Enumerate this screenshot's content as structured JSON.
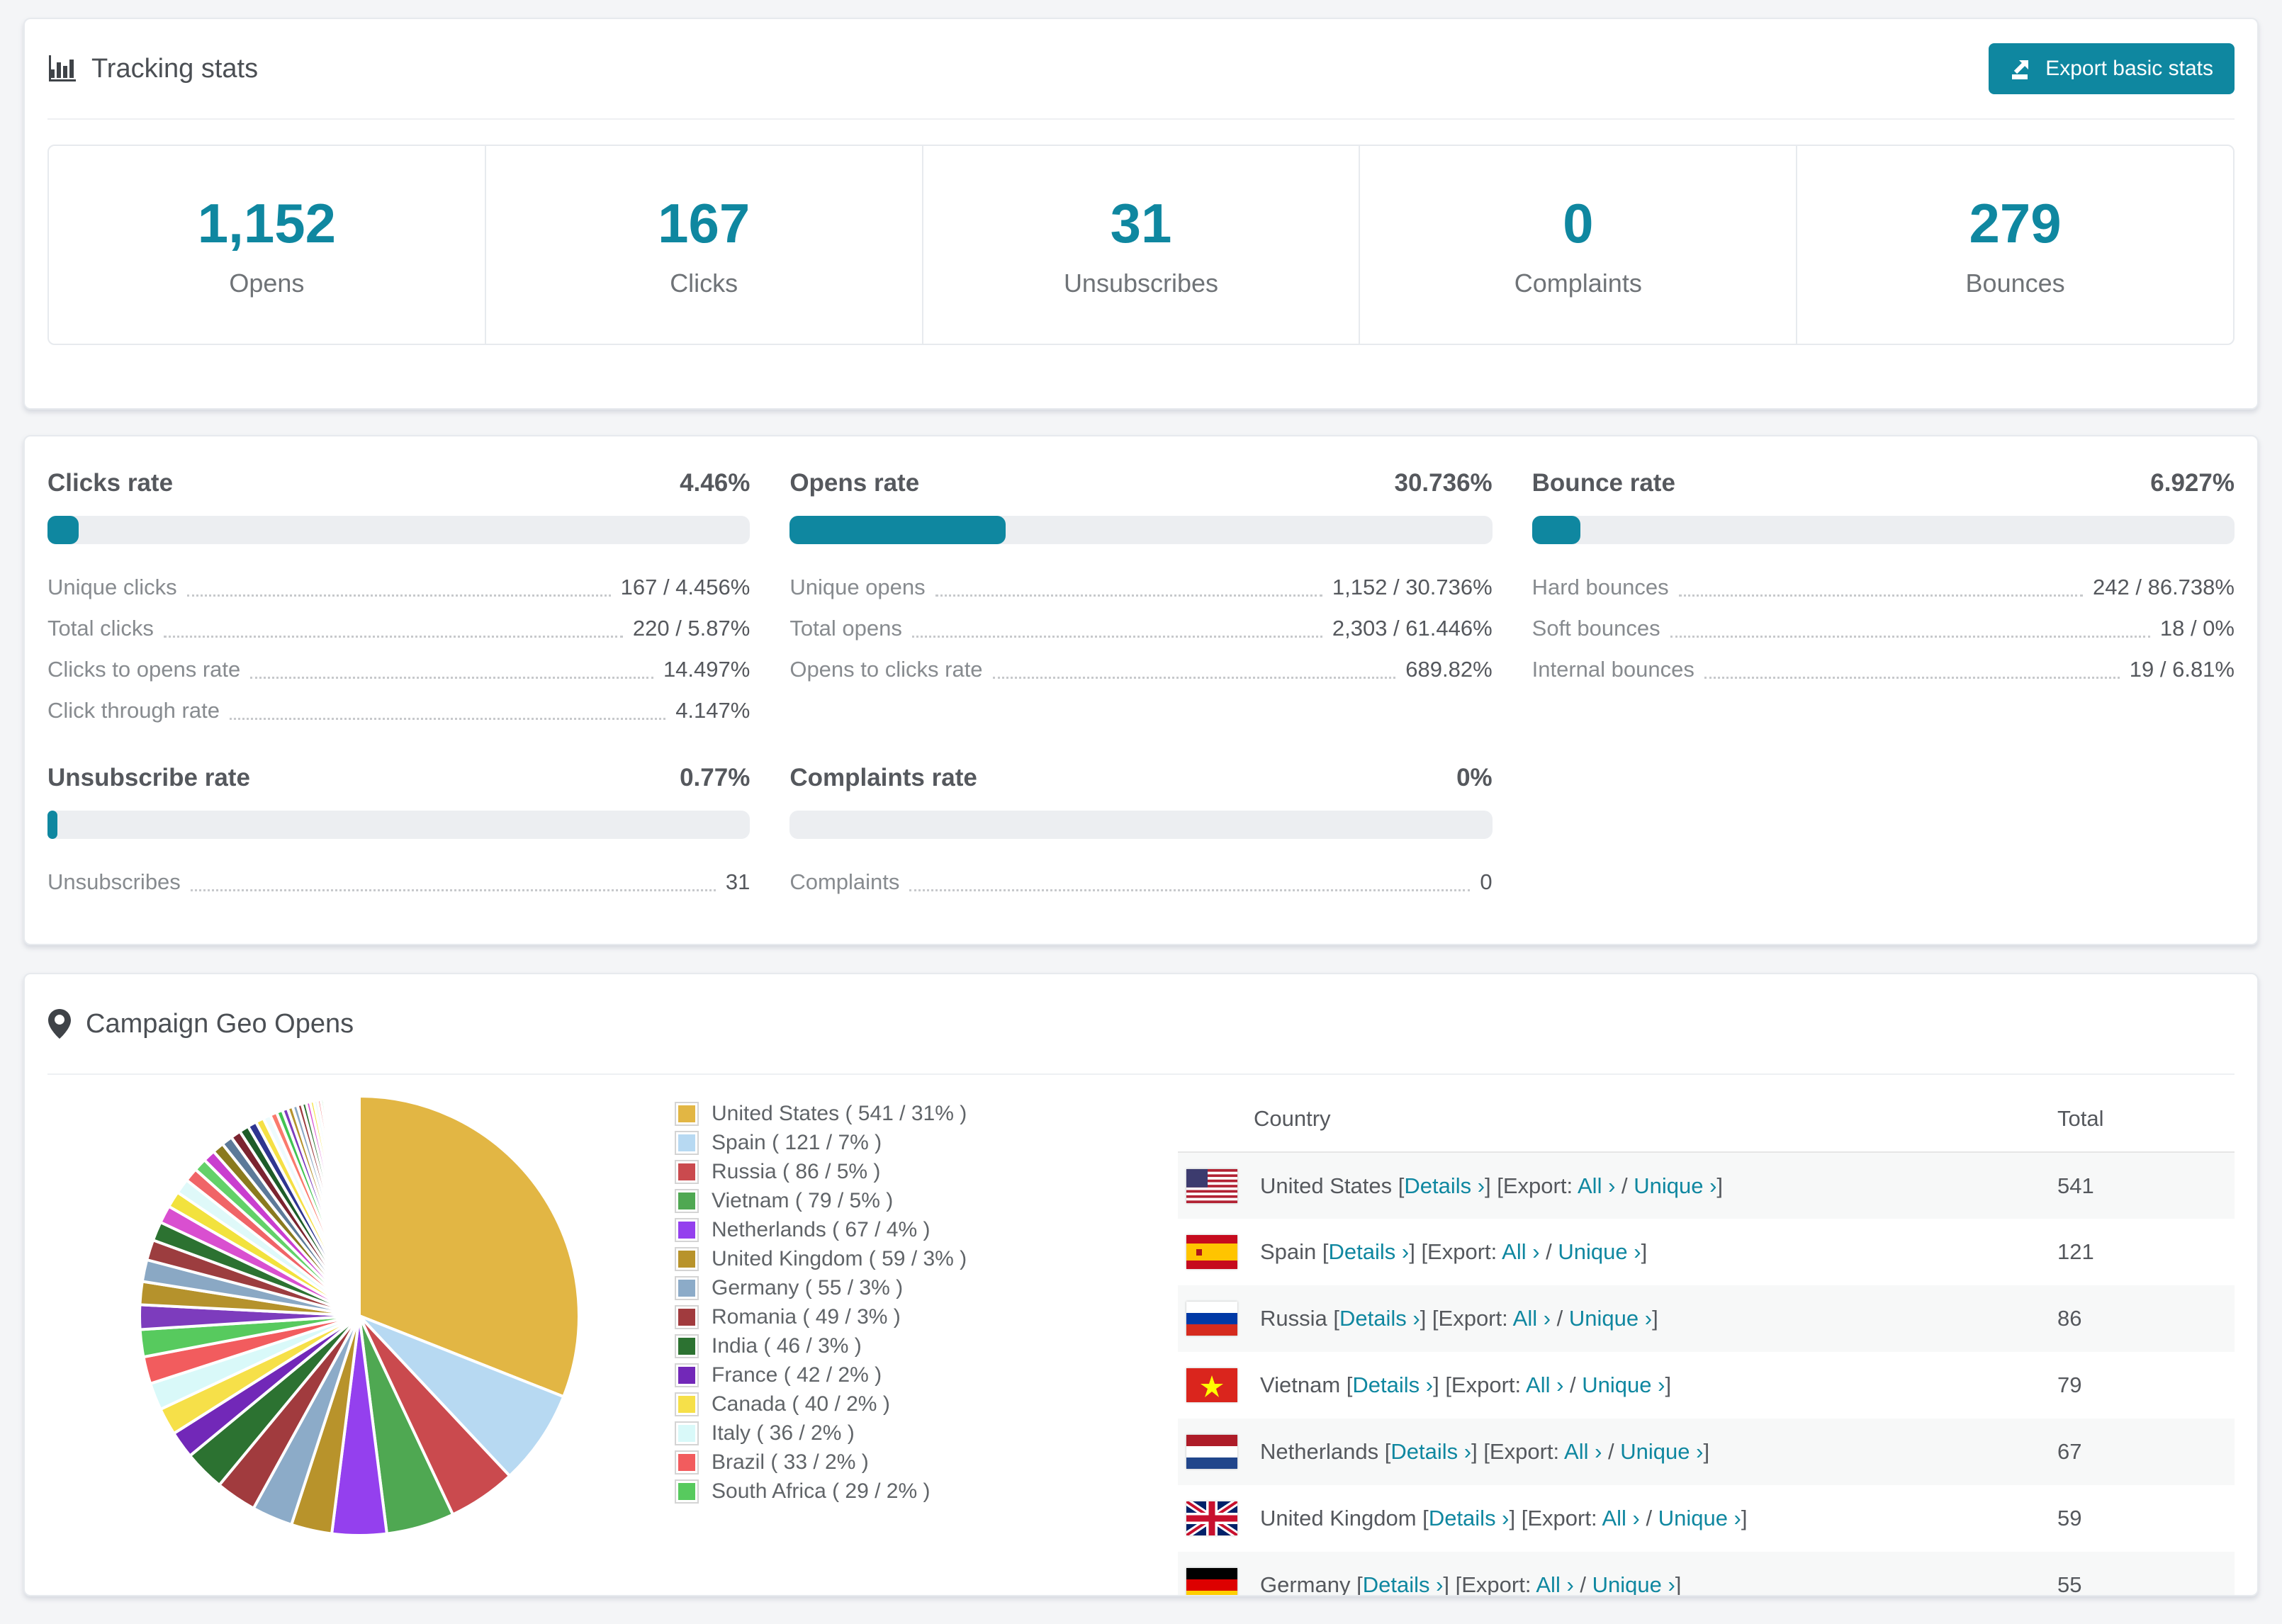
{
  "accent": "#0f87a0",
  "tracking": {
    "title": "Tracking stats",
    "export_button": "Export basic stats",
    "summary": [
      {
        "value": "1,152",
        "label": "Opens"
      },
      {
        "value": "167",
        "label": "Clicks"
      },
      {
        "value": "31",
        "label": "Unsubscribes"
      },
      {
        "value": "0",
        "label": "Complaints"
      },
      {
        "value": "279",
        "label": "Bounces"
      }
    ]
  },
  "rates": {
    "blocks": [
      {
        "title": "Clicks rate",
        "percent": "4.46%",
        "bar_pct": 4.46,
        "rows": [
          [
            "Unique clicks",
            "167 / 4.456%"
          ],
          [
            "Total clicks",
            "220 / 5.87%"
          ],
          [
            "Clicks to opens rate",
            "14.497%"
          ],
          [
            "Click through rate",
            "4.147%"
          ]
        ]
      },
      {
        "title": "Opens rate",
        "percent": "30.736%",
        "bar_pct": 30.736,
        "rows": [
          [
            "Unique opens",
            "1,152 / 30.736%"
          ],
          [
            "Total opens",
            "2,303 / 61.446%"
          ],
          [
            "Opens to clicks rate",
            "689.82%"
          ]
        ]
      },
      {
        "title": "Bounce rate",
        "percent": "6.927%",
        "bar_pct": 6.927,
        "rows": [
          [
            "Hard bounces",
            "242 / 86.738%"
          ],
          [
            "Soft bounces",
            "18 / 0%"
          ],
          [
            "Internal bounces",
            "19 / 6.81%"
          ]
        ]
      },
      {
        "title": "Unsubscribe rate",
        "percent": "0.77%",
        "bar_pct": 0.77,
        "rows": [
          [
            "Unsubscribes",
            "31"
          ]
        ]
      },
      {
        "title": "Complaints rate",
        "percent": "0%",
        "bar_pct": 0,
        "rows": [
          [
            "Complaints",
            "0"
          ]
        ]
      }
    ]
  },
  "geo": {
    "title": "Campaign Geo Opens",
    "legend": [
      {
        "name": "United States",
        "count": 541,
        "pct": 31,
        "color": "#e2b644",
        "flag": "us"
      },
      {
        "name": "Spain",
        "count": 121,
        "pct": 7,
        "color": "#b7d9f2",
        "flag": "es"
      },
      {
        "name": "Russia",
        "count": 86,
        "pct": 5,
        "color": "#ca4a4e",
        "flag": "ru"
      },
      {
        "name": "Vietnam",
        "count": 79,
        "pct": 5,
        "color": "#4fa852",
        "flag": "vn"
      },
      {
        "name": "Netherlands",
        "count": 67,
        "pct": 4,
        "color": "#9440ee",
        "flag": "nl"
      },
      {
        "name": "United Kingdom",
        "count": 59,
        "pct": 3,
        "color": "#b8932b",
        "flag": "gb"
      },
      {
        "name": "Germany",
        "count": 55,
        "pct": 3,
        "color": "#8cabc8",
        "flag": "de"
      },
      {
        "name": "Romania",
        "count": 49,
        "pct": 3,
        "color": "#a13b3e",
        "flag": "ro"
      },
      {
        "name": "India",
        "count": 46,
        "pct": 3,
        "color": "#2c7231",
        "flag": "in"
      },
      {
        "name": "France",
        "count": 42,
        "pct": 2,
        "color": "#7228b8",
        "flag": "fr"
      },
      {
        "name": "Canada",
        "count": 40,
        "pct": 2,
        "color": "#f6e049",
        "flag": "ca"
      },
      {
        "name": "Italy",
        "count": 36,
        "pct": 2,
        "color": "#d9f9f9",
        "flag": "it"
      },
      {
        "name": "Brazil",
        "count": 33,
        "pct": 2,
        "color": "#f25c5e",
        "flag": "br"
      },
      {
        "name": "South Africa",
        "count": 29,
        "pct": 2,
        "color": "#57ca5e",
        "flag": "za"
      }
    ],
    "table": {
      "headers": {
        "country": "Country",
        "total": "Total"
      },
      "link_labels": {
        "details": "Details ›",
        "export_prefix": "[Export:",
        "all": "All ›",
        "unique": "Unique ›"
      },
      "rows": [
        {
          "flag": "us",
          "name": "United States",
          "total": "541"
        },
        {
          "flag": "es",
          "name": "Spain",
          "total": "121"
        },
        {
          "flag": "ru",
          "name": "Russia",
          "total": "86"
        },
        {
          "flag": "vn",
          "name": "Vietnam",
          "total": "79"
        },
        {
          "flag": "nl",
          "name": "Netherlands",
          "total": "67"
        },
        {
          "flag": "gb",
          "name": "United Kingdom",
          "total": "59"
        },
        {
          "flag": "de",
          "name": "Germany",
          "total": "55"
        }
      ]
    }
  },
  "chart_data": {
    "type": "pie",
    "title": "Campaign Geo Opens",
    "legend_position": "right",
    "start_angle_deg": 0,
    "direction": "clockwise",
    "slices": [
      {
        "label": "United States",
        "value": 31,
        "count": 541,
        "color": "#e2b644"
      },
      {
        "label": "Spain",
        "value": 7,
        "count": 121,
        "color": "#b7d9f2"
      },
      {
        "label": "Russia",
        "value": 5,
        "count": 86,
        "color": "#ca4a4e"
      },
      {
        "label": "Vietnam",
        "value": 5,
        "count": 79,
        "color": "#4fa852"
      },
      {
        "label": "Netherlands",
        "value": 4,
        "count": 67,
        "color": "#9440ee"
      },
      {
        "label": "United Kingdom",
        "value": 3,
        "count": 59,
        "color": "#b8932b"
      },
      {
        "label": "Germany",
        "value": 3,
        "count": 55,
        "color": "#8cabc8"
      },
      {
        "label": "Romania",
        "value": 3,
        "count": 49,
        "color": "#a13b3e"
      },
      {
        "label": "India",
        "value": 3,
        "count": 46,
        "color": "#2c7231"
      },
      {
        "label": "France",
        "value": 2,
        "count": 42,
        "color": "#7228b8"
      },
      {
        "label": "Canada",
        "value": 2,
        "count": 40,
        "color": "#f6e049"
      },
      {
        "label": "Italy",
        "value": 2,
        "count": 36,
        "color": "#d9f9f9"
      },
      {
        "label": "Brazil",
        "value": 2,
        "count": 33,
        "color": "#f25c5e"
      },
      {
        "label": "South Africa",
        "value": 2,
        "count": 29,
        "color": "#57ca5e"
      }
    ],
    "others": {
      "note": "long tail of small countries, each ~1% or less",
      "values": [
        1.8,
        1.7,
        1.6,
        1.5,
        1.4,
        1.3,
        1.2,
        1.1,
        1.0,
        0.95,
        0.9,
        0.85,
        0.8,
        0.75,
        0.7,
        0.65,
        0.6,
        0.55,
        0.5,
        0.45,
        0.4,
        0.38,
        0.36,
        0.34,
        0.32,
        0.3,
        0.28,
        0.26,
        0.24,
        0.22,
        0.2,
        0.18,
        0.16,
        0.14,
        0.12,
        0.1,
        0.09,
        0.08,
        0.07,
        0.06
      ],
      "palette": [
        "#7d3cbd",
        "#b5922c",
        "#8aa8c4",
        "#9c3d3f",
        "#2c7231",
        "#d94fd0",
        "#f2e23d",
        "#dff9f9",
        "#f06467",
        "#63d169",
        "#c93ecf",
        "#8a7a1e",
        "#5c7a99",
        "#7b2430",
        "#1e5c28",
        "#2f3590",
        "#f5e045",
        "#eefbfd",
        "#fa7a6c",
        "#41c451"
      ]
    }
  }
}
